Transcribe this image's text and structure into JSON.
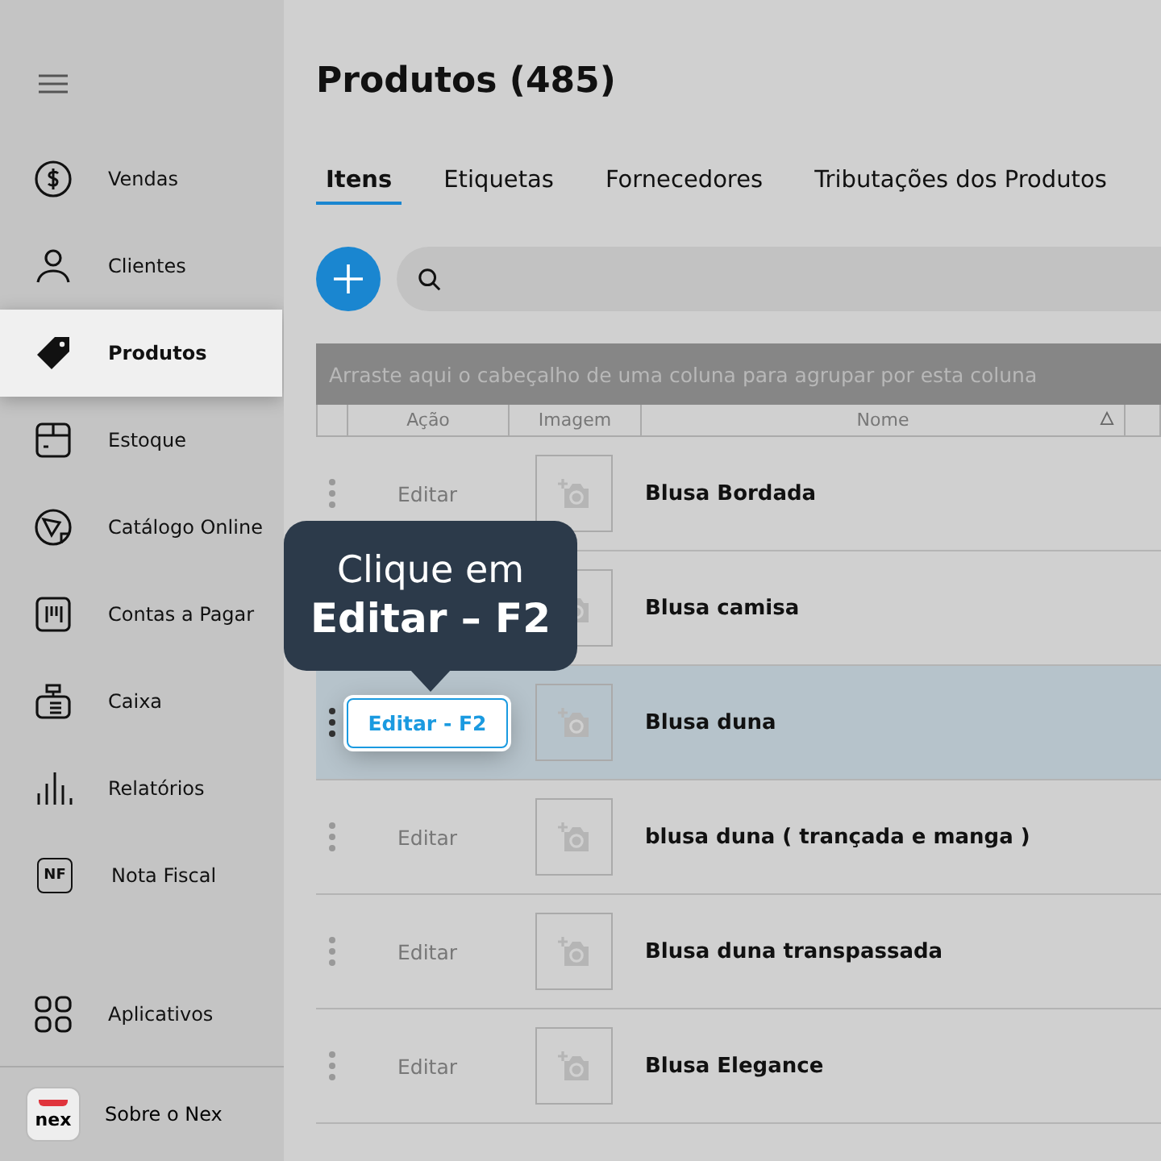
{
  "sidebar": {
    "items": [
      {
        "label": "Vendas",
        "selected": false
      },
      {
        "label": "Clientes",
        "selected": false
      },
      {
        "label": "Produtos",
        "selected": true
      },
      {
        "label": "Estoque",
        "selected": false
      },
      {
        "label": "Catálogo Online",
        "selected": false
      },
      {
        "label": "Contas a Pagar",
        "selected": false
      },
      {
        "label": "Caixa",
        "selected": false
      },
      {
        "label": "Relatórios",
        "selected": false
      },
      {
        "label": "Nota Fiscal",
        "selected": false
      }
    ],
    "bottom_items": [
      {
        "label": "Aplicativos"
      }
    ],
    "about": {
      "label": "Sobre o Nex",
      "logo_text": "nex"
    },
    "nf_icon_text": "NF"
  },
  "title": "Produtos (485)",
  "tabs": [
    {
      "label": "Itens",
      "selected": true
    },
    {
      "label": "Etiquetas",
      "selected": false
    },
    {
      "label": "Fornecedores",
      "selected": false
    },
    {
      "label": "Tributações dos Produtos",
      "selected": false
    }
  ],
  "group_bar": "Arraste aqui o cabeçalho de uma coluna para agrupar por esta coluna",
  "table": {
    "columns": [
      "Ação",
      "Imagem",
      "Nome"
    ],
    "rows": [
      {
        "action": "Editar",
        "name": "Blusa Bordada",
        "selected": false
      },
      {
        "name": "Blusa camisa",
        "selected": false
      },
      {
        "action": "Editar - F2",
        "name": "Blusa duna",
        "selected": true
      },
      {
        "action": "Editar",
        "name": "blusa duna ( trançada e manga )",
        "selected": false
      },
      {
        "action": "Editar",
        "name": "Blusa duna transpassada",
        "selected": false
      },
      {
        "action": "Editar",
        "name": "Blusa Elegance",
        "selected": false
      }
    ]
  },
  "tooltip": {
    "line1": "Clique em",
    "line2": "Editar – F2"
  }
}
